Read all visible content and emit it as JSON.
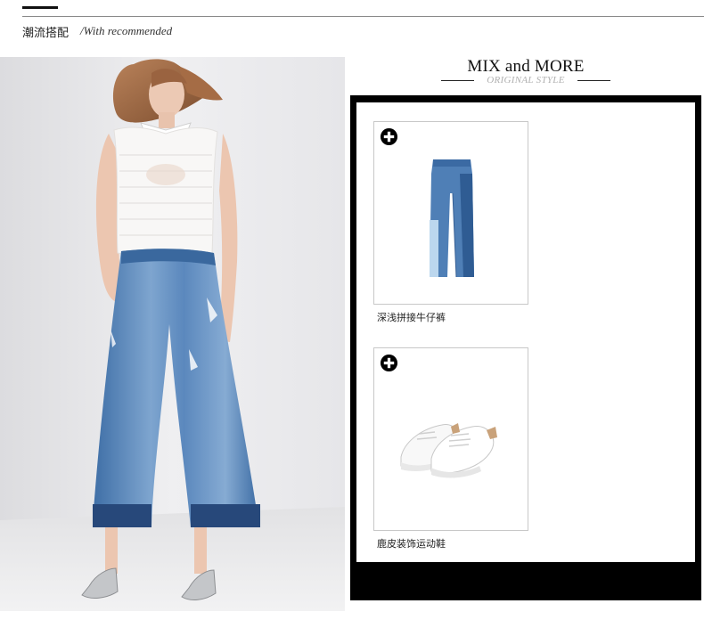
{
  "header": {
    "title": "潮流搭配",
    "subtitle": "/With recommended"
  },
  "mix": {
    "title": "MIX and MORE",
    "subtitle": "ORIGINAL STYLE"
  },
  "products": [
    {
      "name": "深浅拼接牛仔裤",
      "icon": "plus-circle-icon"
    },
    {
      "name": "鹿皮装饰运动鞋",
      "icon": "plus-circle-icon"
    }
  ],
  "colors": {
    "frame": "#000000",
    "denim": "#4f7fb6",
    "denim_dark": "#26477a",
    "subtitle_gray": "#b0b0b0"
  }
}
